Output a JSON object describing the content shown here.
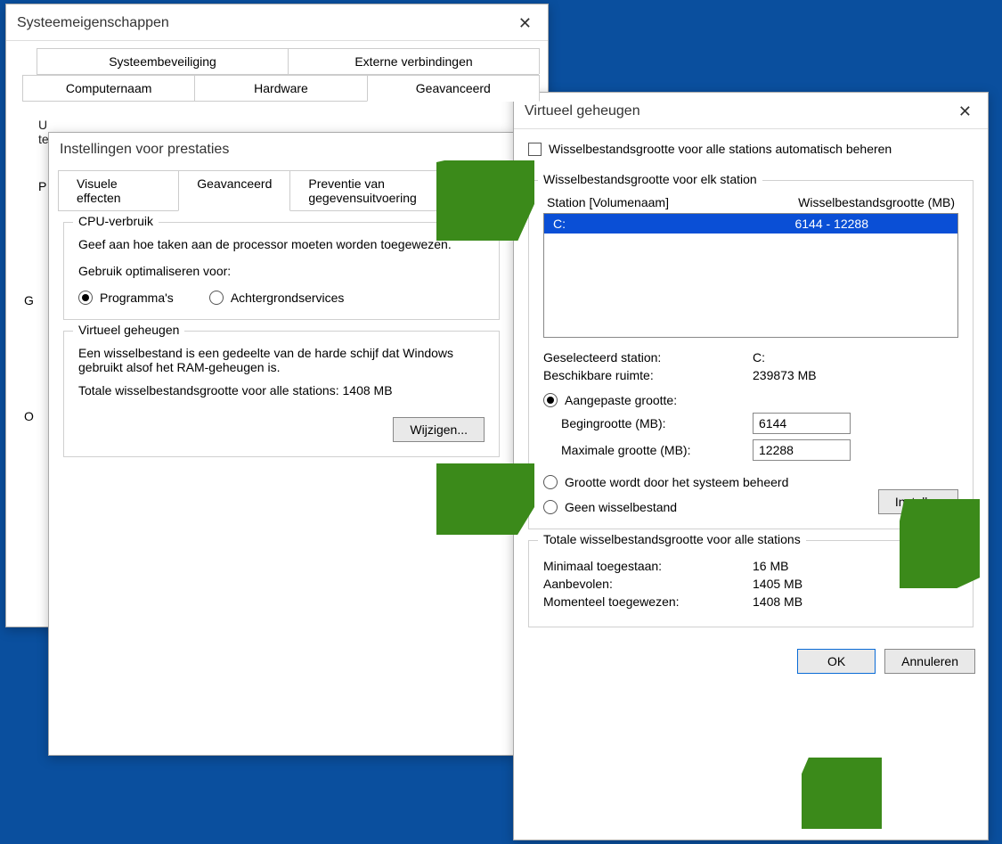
{
  "win1": {
    "title": "Systeemeigenschappen",
    "tabs_upper": [
      "Systeembeveiliging",
      "Externe verbindingen"
    ],
    "tabs_lower": [
      "Computernaam",
      "Hardware",
      "Geavanceerd"
    ],
    "body_fragment_1": "U",
    "body_fragment_2": "te"
  },
  "win2": {
    "title": "Instellingen voor prestaties",
    "tabs": [
      "Visuele effecten",
      "Geavanceerd",
      "Preventie van gegevensuitvoering"
    ],
    "cpu": {
      "legend": "CPU-verbruik",
      "desc": "Geef aan hoe taken aan de processor moeten worden toegewezen.",
      "opt_label": "Gebruik optimaliseren voor:",
      "opt_programs": "Programma's",
      "opt_bg": "Achtergrondservices"
    },
    "vm": {
      "legend": "Virtueel geheugen",
      "desc1": "Een wisselbestand is een gedeelte van de harde schijf dat Windows gebruikt alsof het RAM-geheugen is.",
      "total_label": "Totale wisselbestandsgrootte voor alle stations:",
      "total_value": "1408 MB",
      "change_btn": "Wijzigen..."
    },
    "p_label": "P",
    "g_label": "G",
    "o_label": "O"
  },
  "win3": {
    "title": "Virtueel geheugen",
    "auto_chk": "Wisselbestandsgrootte voor alle stations automatisch beheren",
    "per_station_legend": "Wisselbestandsgrootte voor elk station",
    "col_station": "Station [Volumenaam]",
    "col_size": "Wisselbestandsgrootte (MB)",
    "drives": [
      {
        "name": "C:",
        "size": "6144 - 12288"
      }
    ],
    "selected_station_label": "Geselecteerd station:",
    "selected_station_value": "C:",
    "avail_label": "Beschikbare ruimte:",
    "avail_value": "239873 MB",
    "radio_custom": "Aangepaste grootte:",
    "initial_label": "Begingrootte (MB):",
    "initial_value": "6144",
    "max_label": "Maximale grootte (MB):",
    "max_value": "12288",
    "radio_system": "Grootte wordt door het systeem beheerd",
    "radio_none": "Geen wisselbestand",
    "set_btn": "Instellen",
    "totals_legend": "Totale wisselbestandsgrootte voor alle stations",
    "min_label": "Minimaal toegestaan:",
    "min_value": "16 MB",
    "rec_label": "Aanbevolen:",
    "rec_value": "1405 MB",
    "cur_label": "Momenteel toegewezen:",
    "cur_value": "1408 MB",
    "ok_btn": "OK",
    "cancel_btn": "Annuleren"
  }
}
